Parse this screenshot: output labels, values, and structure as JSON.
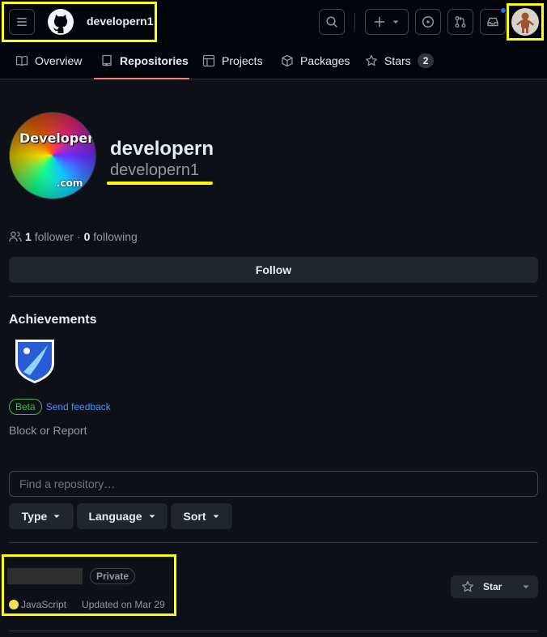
{
  "header": {
    "username": "developern1"
  },
  "tabs": [
    {
      "label": "Overview"
    },
    {
      "label": "Repositories"
    },
    {
      "label": "Projects"
    },
    {
      "label": "Packages"
    },
    {
      "label": "Stars",
      "count": "2"
    }
  ],
  "profile": {
    "name": "developern",
    "login": "developern1",
    "avatar_text_top": "Developer",
    "avatar_text_bottom": ".com",
    "followers_count": "1",
    "followers_label": "follower",
    "separator": "·",
    "following_count": "0",
    "following_label": "following",
    "follow_button": "Follow"
  },
  "achievements": {
    "title": "Achievements",
    "beta_label": "Beta",
    "feedback_link": "Send feedback"
  },
  "block_report": "Block or Report",
  "repo_search": {
    "placeholder": "Find a repository…"
  },
  "filters": [
    {
      "label": "Type"
    },
    {
      "label": "Language"
    },
    {
      "label": "Sort"
    }
  ],
  "repo": {
    "visibility": "Private",
    "language": "JavaScript",
    "language_color": "#f1e05a",
    "updated": "Updated on Mar 29",
    "star_label": "Star"
  },
  "colors": {
    "background": "#0d1117",
    "header_bg": "#010409",
    "highlight": "#ffff00",
    "link": "#4493f8",
    "beta_green": "#3fb950",
    "notification_dot": "#1f6feb"
  }
}
